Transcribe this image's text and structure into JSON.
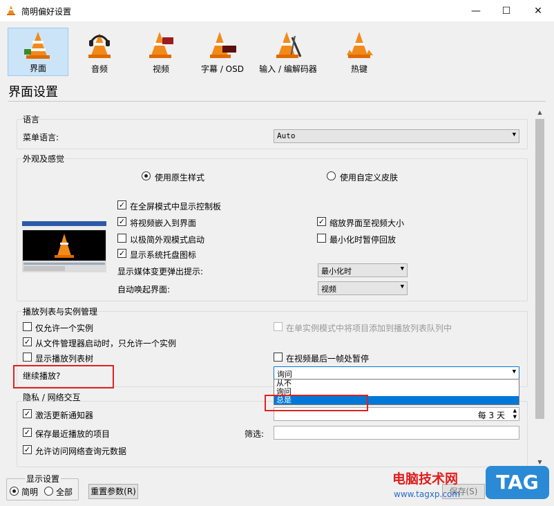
{
  "window": {
    "title": "简明偏好设置",
    "minimize": "—",
    "maximize": "☐",
    "close": "✕"
  },
  "categories": [
    {
      "label": "界面",
      "icon": "interface-cone-icon"
    },
    {
      "label": "音频",
      "icon": "audio-headphones-cone-icon"
    },
    {
      "label": "视频",
      "icon": "video-cone-icon"
    },
    {
      "label": "字幕 / OSD",
      "icon": "subtitle-cone-icon"
    },
    {
      "label": "输入 / 编解码器",
      "icon": "input-codec-cone-icon"
    },
    {
      "label": "热键",
      "icon": "hotkeys-cone-icon"
    }
  ],
  "section_title": "界面设置",
  "language": {
    "group": "语言",
    "label": "菜单语言:",
    "value": "Auto"
  },
  "appearance": {
    "group": "外观及感觉",
    "radio_native": "使用原生样式",
    "radio_custom": "使用自定义皮肤",
    "cb_fullscreen": "在全屏模式中显示控制板",
    "cb_embed": "将视频嵌入到界面",
    "cb_minimal": "以极简外观模式启动",
    "cb_systray": "显示系统托盘图标",
    "cb_resize": "缩放界面至视频大小",
    "cb_pause_min": "最小化时暂停回放",
    "popup_label": "显示媒体变更弹出提示:",
    "popup_value": "最小化时",
    "raise_label": "自动唤起界面:",
    "raise_value": "视频"
  },
  "playlist": {
    "group": "播放列表与实例管理",
    "cb_one_instance": "仅允许一个实例",
    "cb_enqueue": "在单实例模式中将项目添加到播放列表队列中",
    "cb_file_manager": "从文件管理器启动时，只允许一个实例",
    "cb_tree": "显示播放列表树",
    "cb_pause_last": "在视频最后一帧处暂停",
    "resume_label": "继续播放?",
    "resume_value": "询问",
    "resume_options": [
      "从不",
      "询问",
      "总是"
    ]
  },
  "privacy": {
    "group": "隐私 / 网络交互",
    "cb_update": "激活更新通知器",
    "update_value": "每 3 天",
    "cb_recent": "保存最近播放的项目",
    "filter_label": "筛选:",
    "cb_metadata": "允许访问网络查询元数据"
  },
  "footer": {
    "show_group": "显示设置",
    "radio_simple": "简明",
    "radio_all": "全部",
    "reset_button": "重置参数(R)",
    "save_button": "保存(S)"
  },
  "watermark": {
    "text": "电脑技术网",
    "url": "www.tagxp.com",
    "badge": "TAG"
  },
  "colors": {
    "selection": "#cce4f7",
    "dropdown_highlight": "#0078d7",
    "highlight_box": "#e02020",
    "watermark_red": "#e01c1c"
  }
}
